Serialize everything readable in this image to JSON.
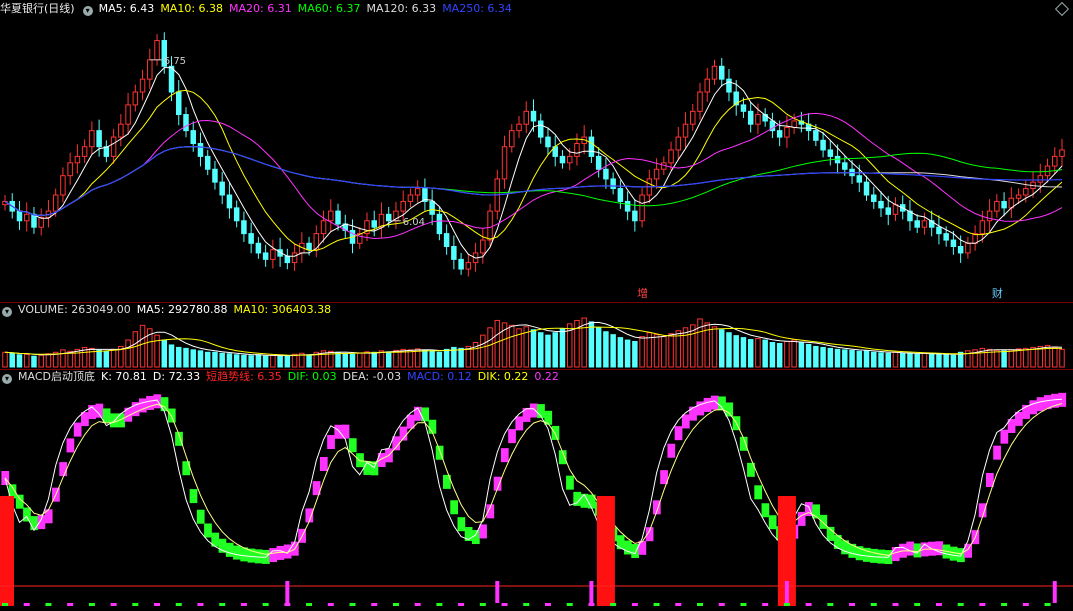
{
  "header_price": {
    "title": "华夏银行(日线)",
    "ma": [
      {
        "label": "MA5: 6.43",
        "color": "#ffffff"
      },
      {
        "label": "MA10: 6.38",
        "color": "#ffff00"
      },
      {
        "label": "MA20: 6.31",
        "color": "#ff33ff"
      },
      {
        "label": "MA60: 6.37",
        "color": "#00ff00"
      },
      {
        "label": "MA120: 6.33",
        "color": "#dddddd"
      },
      {
        "label": "MA250: 6.34",
        "color": "#3344ff"
      }
    ]
  },
  "header_volume": {
    "items": [
      {
        "label": "VOLUME: 263049.00",
        "color": "#dddddd"
      },
      {
        "label": "MA5: 292780.88",
        "color": "#ffffff"
      },
      {
        "label": "MA10: 306403.38",
        "color": "#ffff00"
      }
    ]
  },
  "header_macd": {
    "items": [
      {
        "label": "MACD启动顶底",
        "color": "#dddddd"
      },
      {
        "label": "K: 70.81",
        "color": "#ffffff"
      },
      {
        "label": "D: 72.33",
        "color": "#ffffff"
      },
      {
        "label": "短趋势线: 6.35",
        "color": "#ff2222"
      },
      {
        "label": "DIF: 0.03",
        "color": "#00ff00"
      },
      {
        "label": "DEA: -0.03",
        "color": "#dddddd"
      },
      {
        "label": "MACD: 0.12",
        "color": "#3344ff"
      },
      {
        "label": "DIK: 0.22",
        "color": "#ffff00"
      },
      {
        "label": "0.22",
        "color": "#ff33ff"
      }
    ]
  },
  "chart_data": {
    "type": "candlestick",
    "price_ylim": [
      5.98,
      6.85
    ],
    "annotations": [
      {
        "text": "6.75",
        "index": 20
      },
      {
        "text": "6.04",
        "index": 53
      }
    ],
    "event_markers": [
      {
        "text": "增",
        "index": 88,
        "color": "#ff4444"
      },
      {
        "text": "财",
        "index": 137,
        "color": "#66ccff"
      }
    ],
    "colors": {
      "up": "#ff3333",
      "down": "#55ffff",
      "kdj_up": "#ff33ff",
      "kdj_down": "#22ff22"
    },
    "close": [
      6.28,
      6.25,
      6.22,
      6.24,
      6.2,
      6.23,
      6.25,
      6.3,
      6.36,
      6.4,
      6.42,
      6.45,
      6.5,
      6.45,
      6.42,
      6.48,
      6.52,
      6.58,
      6.62,
      6.66,
      6.72,
      6.78,
      6.7,
      6.62,
      6.55,
      6.5,
      6.46,
      6.42,
      6.38,
      6.34,
      6.3,
      6.26,
      6.22,
      6.18,
      6.15,
      6.12,
      6.1,
      6.13,
      6.11,
      6.09,
      6.12,
      6.15,
      6.13,
      6.18,
      6.22,
      6.25,
      6.21,
      6.19,
      6.15,
      6.18,
      6.22,
      6.2,
      6.24,
      6.22,
      6.25,
      6.28,
      6.3,
      6.32,
      6.28,
      6.24,
      6.18,
      6.14,
      6.1,
      6.07,
      6.09,
      6.12,
      6.16,
      6.25,
      6.35,
      6.45,
      6.5,
      6.52,
      6.56,
      6.53,
      6.48,
      6.45,
      6.42,
      6.4,
      6.42,
      6.46,
      6.48,
      6.42,
      6.38,
      6.35,
      6.32,
      6.28,
      6.25,
      6.22,
      6.3,
      6.35,
      6.38,
      6.4,
      6.44,
      6.48,
      6.52,
      6.56,
      6.62,
      6.66,
      6.7,
      6.66,
      6.62,
      6.58,
      6.56,
      6.52,
      6.55,
      6.53,
      6.5,
      6.48,
      6.51,
      6.53,
      6.52,
      6.5,
      6.47,
      6.44,
      6.42,
      6.4,
      6.38,
      6.36,
      6.34,
      6.3,
      6.28,
      6.26,
      6.24,
      6.27,
      6.25,
      6.22,
      6.2,
      6.22,
      6.2,
      6.18,
      6.16,
      6.14,
      6.12,
      6.15,
      6.18,
      6.22,
      6.25,
      6.28,
      6.26,
      6.29,
      6.3,
      6.32,
      6.34,
      6.36,
      6.39,
      6.42,
      6.44
    ],
    "volume": [
      0.3,
      0.28,
      0.25,
      0.26,
      0.22,
      0.24,
      0.27,
      0.3,
      0.35,
      0.32,
      0.36,
      0.4,
      0.38,
      0.34,
      0.32,
      0.36,
      0.42,
      0.55,
      0.72,
      0.85,
      0.78,
      0.65,
      0.55,
      0.45,
      0.4,
      0.38,
      0.35,
      0.33,
      0.3,
      0.3,
      0.28,
      0.27,
      0.25,
      0.24,
      0.23,
      0.25,
      0.22,
      0.24,
      0.23,
      0.22,
      0.26,
      0.28,
      0.25,
      0.3,
      0.33,
      0.32,
      0.3,
      0.27,
      0.26,
      0.28,
      0.31,
      0.3,
      0.33,
      0.31,
      0.34,
      0.36,
      0.35,
      0.37,
      0.34,
      0.32,
      0.3,
      0.36,
      0.4,
      0.38,
      0.42,
      0.5,
      0.65,
      0.8,
      0.95,
      0.9,
      0.85,
      0.78,
      0.82,
      0.76,
      0.7,
      0.65,
      0.7,
      0.78,
      0.88,
      0.95,
      1.0,
      0.92,
      0.8,
      0.72,
      0.66,
      0.6,
      0.55,
      0.52,
      0.62,
      0.7,
      0.66,
      0.62,
      0.68,
      0.74,
      0.8,
      0.86,
      0.98,
      0.9,
      0.82,
      0.76,
      0.7,
      0.64,
      0.6,
      0.56,
      0.58,
      0.55,
      0.5,
      0.48,
      0.52,
      0.55,
      0.5,
      0.46,
      0.42,
      0.4,
      0.38,
      0.36,
      0.35,
      0.34,
      0.32,
      0.33,
      0.3,
      0.29,
      0.28,
      0.3,
      0.28,
      0.27,
      0.26,
      0.28,
      0.27,
      0.26,
      0.25,
      0.24,
      0.3,
      0.33,
      0.35,
      0.38,
      0.36,
      0.34,
      0.33,
      0.35,
      0.37,
      0.38,
      0.4,
      0.42,
      0.44,
      0.4,
      0.36
    ]
  }
}
